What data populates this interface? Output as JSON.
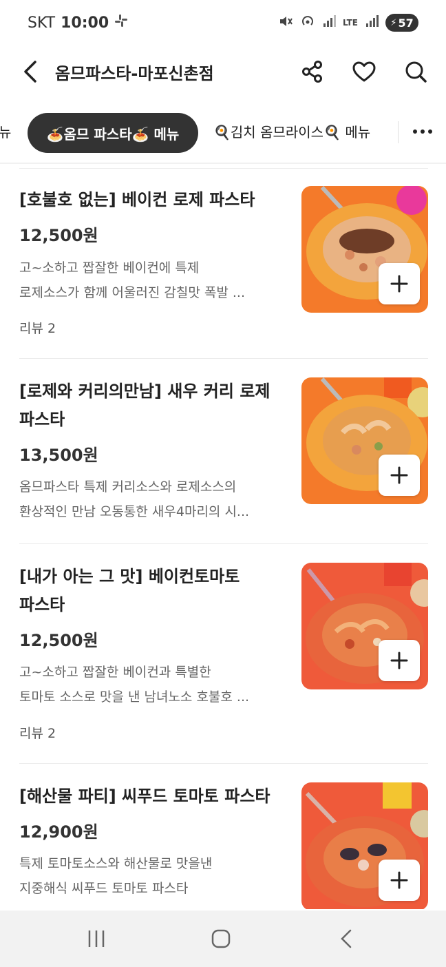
{
  "status_bar": {
    "carrier": "SKT",
    "time": "10:00",
    "network": "LTE",
    "battery": "57"
  },
  "header": {
    "title": "옴므파스타-마포신촌점"
  },
  "tabs": {
    "prev_partial": "뉴",
    "active": "🍝옴므 파스타🍝 메뉴",
    "next": "🍳김치 옴므라이스🍳 메뉴"
  },
  "items": [
    {
      "name_lines": [
        "[호불호 없는] 베이컨 로제 파스타"
      ],
      "price": "12,500원",
      "desc_lines": [
        "고~소하고 짭잘한 베이컨에 특제",
        "로제소스가 함께 어울러진 감칠맛 폭발 ..."
      ],
      "review": "리뷰 2",
      "plate_color": "#f3a43c"
    },
    {
      "name_lines": [
        "[로제와 커리의만남] 새우 커리 로제",
        "파스타"
      ],
      "price": "13,500원",
      "desc_lines": [
        "옴므파스타 특제 커리소스와 로제소스의",
        "환상적인 만남 오동통한 새우4마리의 시..."
      ],
      "review": "",
      "plate_color": "#f3a43c"
    },
    {
      "name_lines": [
        "[내가 아는 그 맛] 베이컨토마토",
        "파스타"
      ],
      "price": "12,500원",
      "desc_lines": [
        "고~소하고 짭잘한 베이컨과 특별한",
        "토마토 소스로 맛을 낸 남녀노소 호불호 ..."
      ],
      "review": "리뷰 2",
      "plate_color": "#e8643c"
    },
    {
      "name_lines": [
        "[해산물 파티] 씨푸드 토마토 파스타"
      ],
      "price": "12,900원",
      "desc_lines": [
        "특제 토마토소스와 해산물로 맛을낸",
        "지중해식 씨푸드 토마토 파스타"
      ],
      "review": "",
      "plate_color": "#e8643c"
    }
  ],
  "icons": {
    "back": "back-arrow-icon",
    "share": "share-icon",
    "favorite": "heart-icon",
    "search": "search-icon",
    "add": "plus-icon"
  },
  "colors": {
    "active_tab_bg": "#333333",
    "food_bg_orange": "#f5782e",
    "food_bg_red": "#ef5a3a"
  }
}
